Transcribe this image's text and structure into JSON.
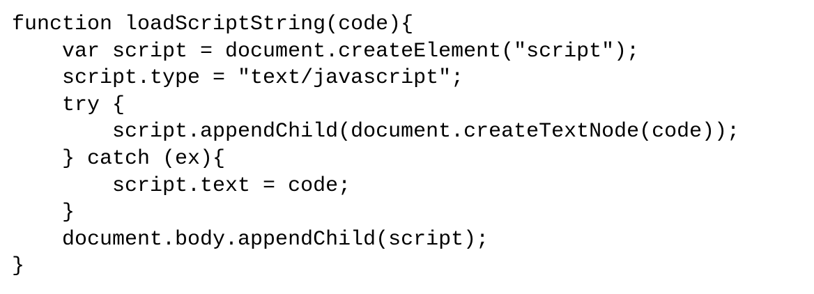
{
  "code": {
    "lines": [
      "function loadScriptString(code){",
      "    var script = document.createElement(\"script\");",
      "    script.type = \"text/javascript\";",
      "    try {",
      "        script.appendChild(document.createTextNode(code));",
      "    } catch (ex){",
      "        script.text = code;",
      "    }",
      "    document.body.appendChild(script);",
      "}"
    ]
  }
}
